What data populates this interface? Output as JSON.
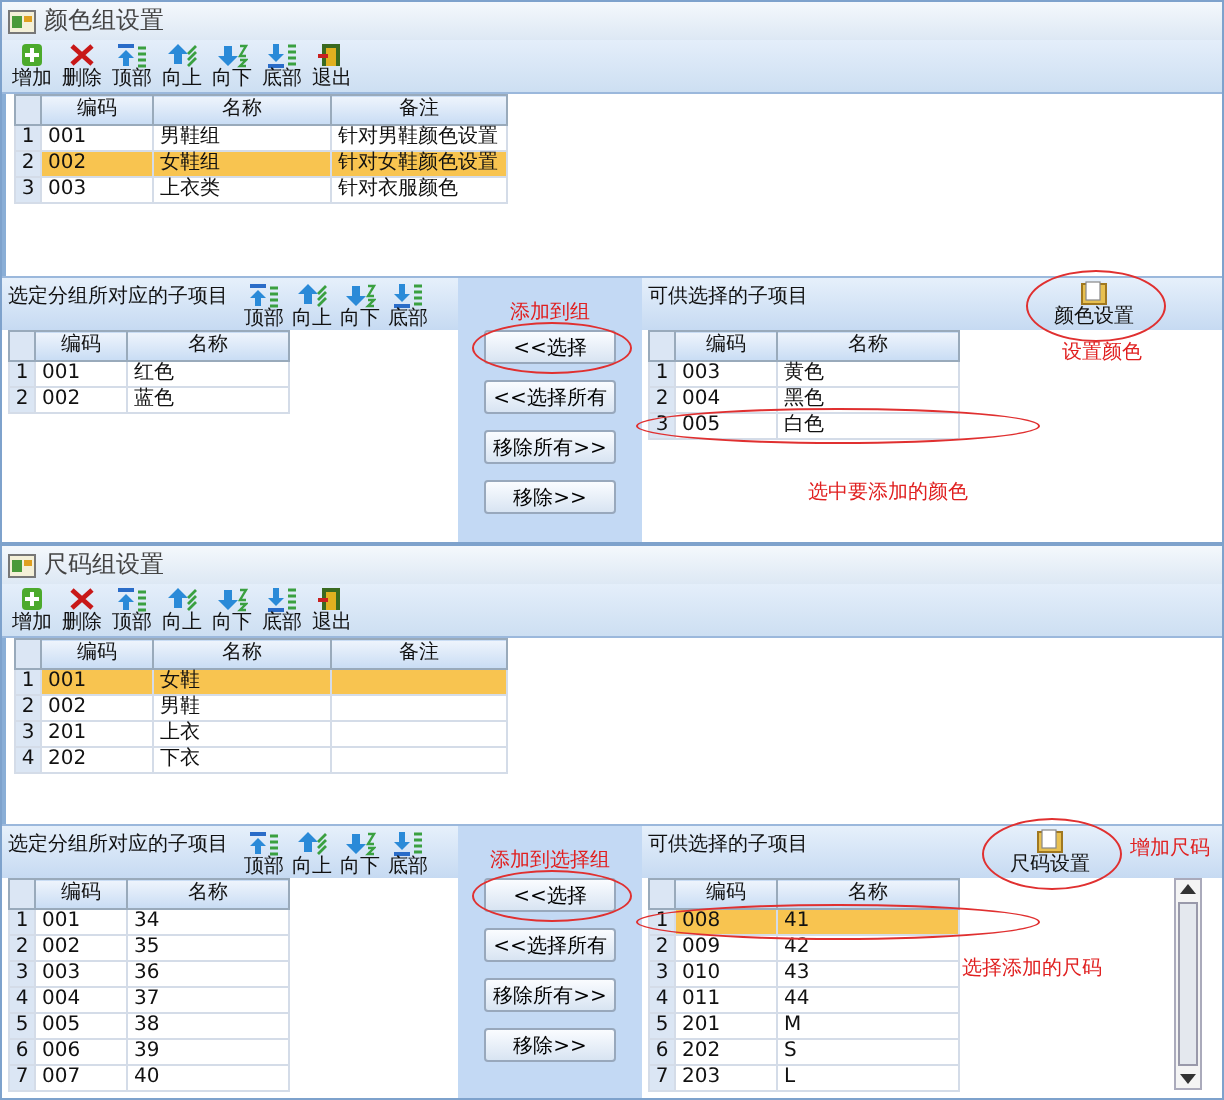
{
  "panels": [
    {
      "title": "颜色组设置",
      "toolbar": [
        {
          "kind": "add",
          "label": "增加"
        },
        {
          "kind": "delete",
          "label": "删除"
        },
        {
          "kind": "top",
          "label": "顶部"
        },
        {
          "kind": "up",
          "label": "向上"
        },
        {
          "kind": "down",
          "label": "向下"
        },
        {
          "kind": "bottom",
          "label": "底部"
        },
        {
          "kind": "exit",
          "label": "退出"
        }
      ],
      "table": {
        "columns": [
          "编码",
          "名称",
          "备注"
        ],
        "rows": [
          {
            "num": "1",
            "cells": [
              "001",
              "男鞋组",
              "针对男鞋颜色设置"
            ],
            "selected": false
          },
          {
            "num": "2",
            "cells": [
              "002",
              "女鞋组",
              "针对女鞋颜色设置"
            ],
            "selected": true
          },
          {
            "num": "3",
            "cells": [
              "003",
              "上衣类",
              "针对衣服颜色"
            ],
            "selected": false
          }
        ]
      },
      "left": {
        "label": "选定分组所对应的子项目",
        "toolbar": [
          {
            "kind": "top",
            "label": "顶部"
          },
          {
            "kind": "up",
            "label": "向上"
          },
          {
            "kind": "down",
            "label": "向下"
          },
          {
            "kind": "bottom",
            "label": "底部"
          }
        ],
        "columns": [
          "编码",
          "名称"
        ],
        "rows": [
          {
            "num": "1",
            "cells": [
              "001",
              "红色"
            ],
            "selected": false
          },
          {
            "num": "2",
            "cells": [
              "002",
              "蓝色"
            ],
            "selected": false
          }
        ]
      },
      "button_note": "添加到组",
      "buttons": [
        {
          "label": "<<选择",
          "circled": true
        },
        {
          "label": "<<选择所有",
          "circled": false
        },
        {
          "label": "移除所有>>",
          "circled": false
        },
        {
          "label": "移除>>",
          "circled": false
        }
      ],
      "right": {
        "label": "可供选择的子项目",
        "settings": {
          "label": "颜色设置",
          "circled": true
        },
        "settings_note": "设置颜色",
        "columns": [
          "编码",
          "名称"
        ],
        "rows": [
          {
            "num": "1",
            "cells": [
              "003",
              "黄色"
            ],
            "selected": false,
            "circled": false
          },
          {
            "num": "2",
            "cells": [
              "004",
              "黑色"
            ],
            "selected": false,
            "circled": false
          },
          {
            "num": "3",
            "cells": [
              "005",
              "白色"
            ],
            "selected": false,
            "circled": true
          }
        ],
        "row_note": "选中要添加的颜色",
        "scrollbar": false
      }
    },
    {
      "title": "尺码组设置",
      "toolbar": [
        {
          "kind": "add",
          "label": "增加"
        },
        {
          "kind": "delete",
          "label": "删除"
        },
        {
          "kind": "top",
          "label": "顶部"
        },
        {
          "kind": "up",
          "label": "向上"
        },
        {
          "kind": "down",
          "label": "向下"
        },
        {
          "kind": "bottom",
          "label": "底部"
        },
        {
          "kind": "exit",
          "label": "退出"
        }
      ],
      "table": {
        "columns": [
          "编码",
          "名称",
          "备注"
        ],
        "rows": [
          {
            "num": "1",
            "cells": [
              "001",
              "女鞋",
              ""
            ],
            "selected": true
          },
          {
            "num": "2",
            "cells": [
              "002",
              "男鞋",
              ""
            ],
            "selected": false
          },
          {
            "num": "3",
            "cells": [
              "201",
              "上衣",
              ""
            ],
            "selected": false
          },
          {
            "num": "4",
            "cells": [
              "202",
              "下衣",
              ""
            ],
            "selected": false
          }
        ]
      },
      "left": {
        "label": "选定分组所对应的子项目",
        "toolbar": [
          {
            "kind": "top",
            "label": "顶部"
          },
          {
            "kind": "up",
            "label": "向上"
          },
          {
            "kind": "down",
            "label": "向下"
          },
          {
            "kind": "bottom",
            "label": "底部"
          }
        ],
        "columns": [
          "编码",
          "名称"
        ],
        "rows": [
          {
            "num": "1",
            "cells": [
              "001",
              "34"
            ],
            "selected": false
          },
          {
            "num": "2",
            "cells": [
              "002",
              "35"
            ],
            "selected": false
          },
          {
            "num": "3",
            "cells": [
              "003",
              "36"
            ],
            "selected": false
          },
          {
            "num": "4",
            "cells": [
              "004",
              "37"
            ],
            "selected": false
          },
          {
            "num": "5",
            "cells": [
              "005",
              "38"
            ],
            "selected": false
          },
          {
            "num": "6",
            "cells": [
              "006",
              "39"
            ],
            "selected": false
          },
          {
            "num": "7",
            "cells": [
              "007",
              "40"
            ],
            "selected": false
          }
        ]
      },
      "button_note": "添加到选择组",
      "buttons": [
        {
          "label": "<<选择",
          "circled": true
        },
        {
          "label": "<<选择所有",
          "circled": false
        },
        {
          "label": "移除所有>>",
          "circled": false
        },
        {
          "label": "移除>>",
          "circled": false
        }
      ],
      "right": {
        "label": "可供选择的子项目",
        "settings": {
          "label": "尺码设置",
          "circled": true
        },
        "settings_note": "增加尺码",
        "columns": [
          "编码",
          "名称"
        ],
        "rows": [
          {
            "num": "1",
            "cells": [
              "008",
              "41"
            ],
            "selected": true,
            "circled": true
          },
          {
            "num": "2",
            "cells": [
              "009",
              "42"
            ],
            "selected": false,
            "circled": false
          },
          {
            "num": "3",
            "cells": [
              "010",
              "43"
            ],
            "selected": false,
            "circled": false
          },
          {
            "num": "4",
            "cells": [
              "011",
              "44"
            ],
            "selected": false,
            "circled": false
          },
          {
            "num": "5",
            "cells": [
              "201",
              "M"
            ],
            "selected": false,
            "circled": false
          },
          {
            "num": "6",
            "cells": [
              "202",
              "S"
            ],
            "selected": false,
            "circled": false
          },
          {
            "num": "7",
            "cells": [
              "203",
              "L"
            ],
            "selected": false,
            "circled": false
          }
        ],
        "row_note": "选择添加的尺码",
        "scrollbar": true
      }
    }
  ]
}
